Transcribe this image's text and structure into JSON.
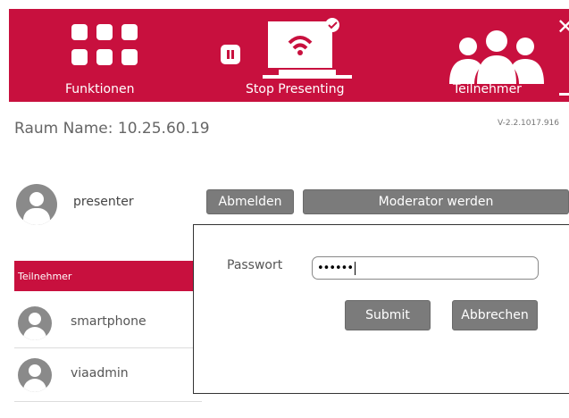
{
  "topbar": {
    "functions_label": "Funktionen",
    "presenting_label": "Stop Presenting",
    "participants_label": "Teilnehmer",
    "accent_color": "#c8103e"
  },
  "room": {
    "label": "Raum Name: 10.25.60.19",
    "version": "V-2.2.1017.916"
  },
  "presenter": {
    "name": "presenter",
    "logout_label": "Abmelden",
    "moderator_label": "Moderator werden"
  },
  "participants": {
    "header": "Teilnehmer",
    "items": [
      {
        "name": "smartphone"
      },
      {
        "name": "viaadmin"
      }
    ]
  },
  "dialog": {
    "password_label": "Passwort",
    "password_value": "••••••",
    "submit_label": "Submit",
    "cancel_label": "Abbrechen"
  },
  "icons": {
    "functions": "grid-icon",
    "pause": "pause-icon",
    "presenting": "monitor-wifi-icon",
    "participants": "people-icon",
    "close": "close-icon",
    "minimize": "minus-icon",
    "avatar": "user-avatar-icon"
  }
}
